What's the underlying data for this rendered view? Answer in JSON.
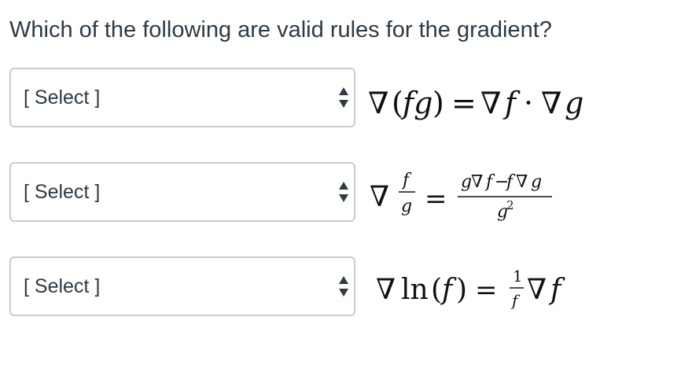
{
  "question": {
    "text": "Which of the following are valid rules for the gradient?"
  },
  "rows": [
    {
      "select": {
        "value": "[ Select ]"
      },
      "formula": {
        "text": "∇(fg) = ∇f · ∇g"
      }
    },
    {
      "select": {
        "value": "[ Select ]"
      },
      "formula": {
        "text": "∇ f/g = (g∇f − f∇g)/g²"
      }
    },
    {
      "select": {
        "value": "[ Select ]"
      },
      "formula": {
        "text": "∇ ln(f) = 1/f ∇f"
      }
    }
  ],
  "icons": {
    "select_arrows": "up-down-arrows-icon"
  },
  "colors": {
    "text": "#2d3b45",
    "border": "#c7cdd1",
    "background": "#ffffff"
  }
}
